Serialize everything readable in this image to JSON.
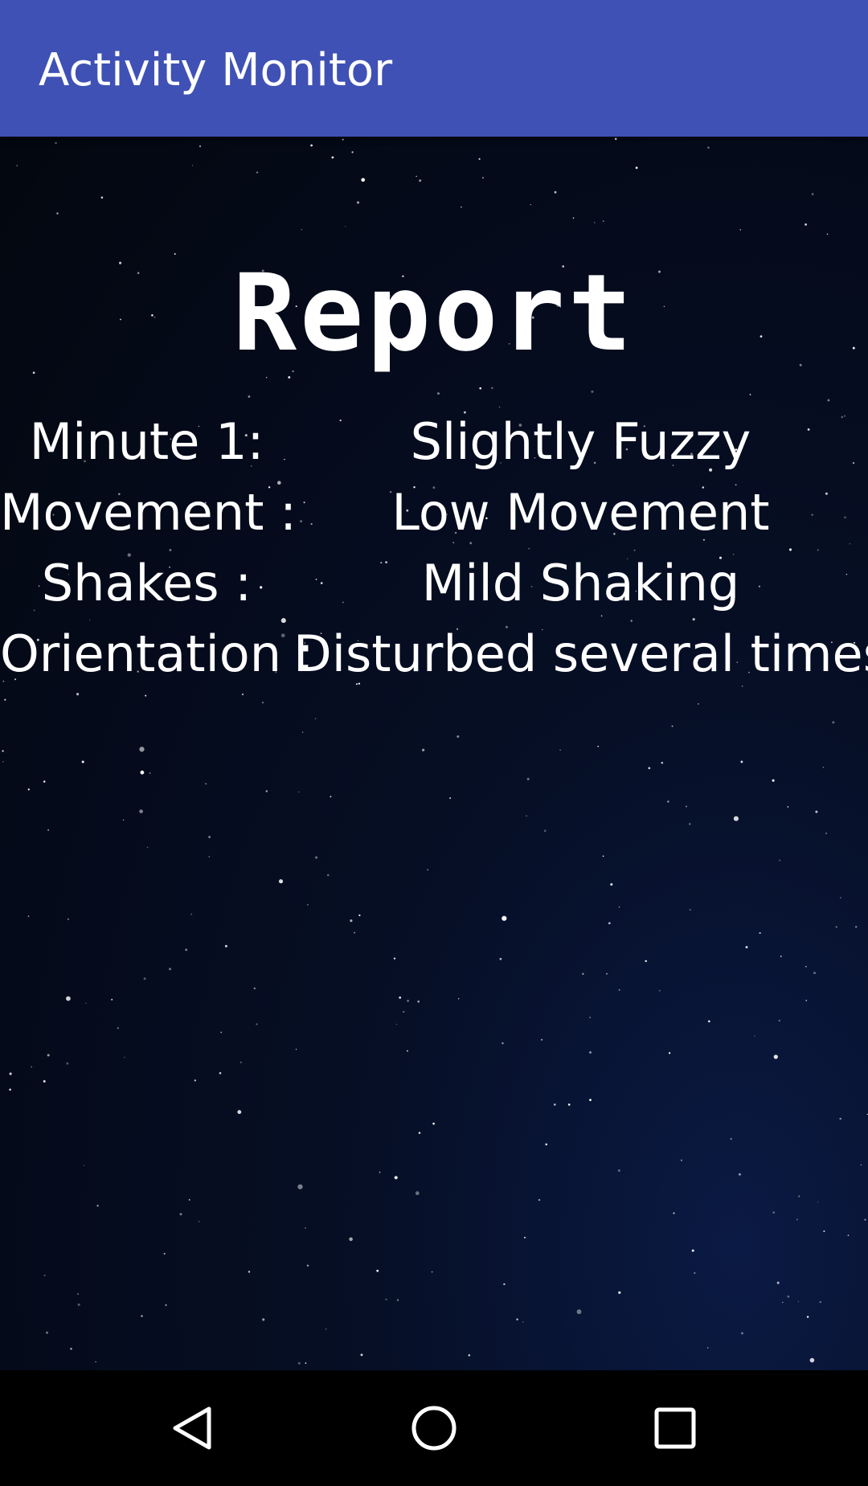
{
  "app_bar": {
    "title": "Activity Monitor"
  },
  "report": {
    "heading": "Report",
    "rows": [
      {
        "label": "Minute 1:",
        "value": "Slightly Fuzzy"
      },
      {
        "label": "Movement :",
        "value": "Low Movement"
      },
      {
        "label": "Shakes :",
        "value": "Mild Shaking"
      },
      {
        "label": "Orientation :",
        "value": "Disturbed several times"
      }
    ]
  },
  "nav_bar": {
    "buttons": [
      "back-icon",
      "home-icon",
      "recents-icon"
    ]
  },
  "colors": {
    "app_bar": "#3f51b5",
    "text": "#ffffff",
    "background": "#050b1c"
  }
}
